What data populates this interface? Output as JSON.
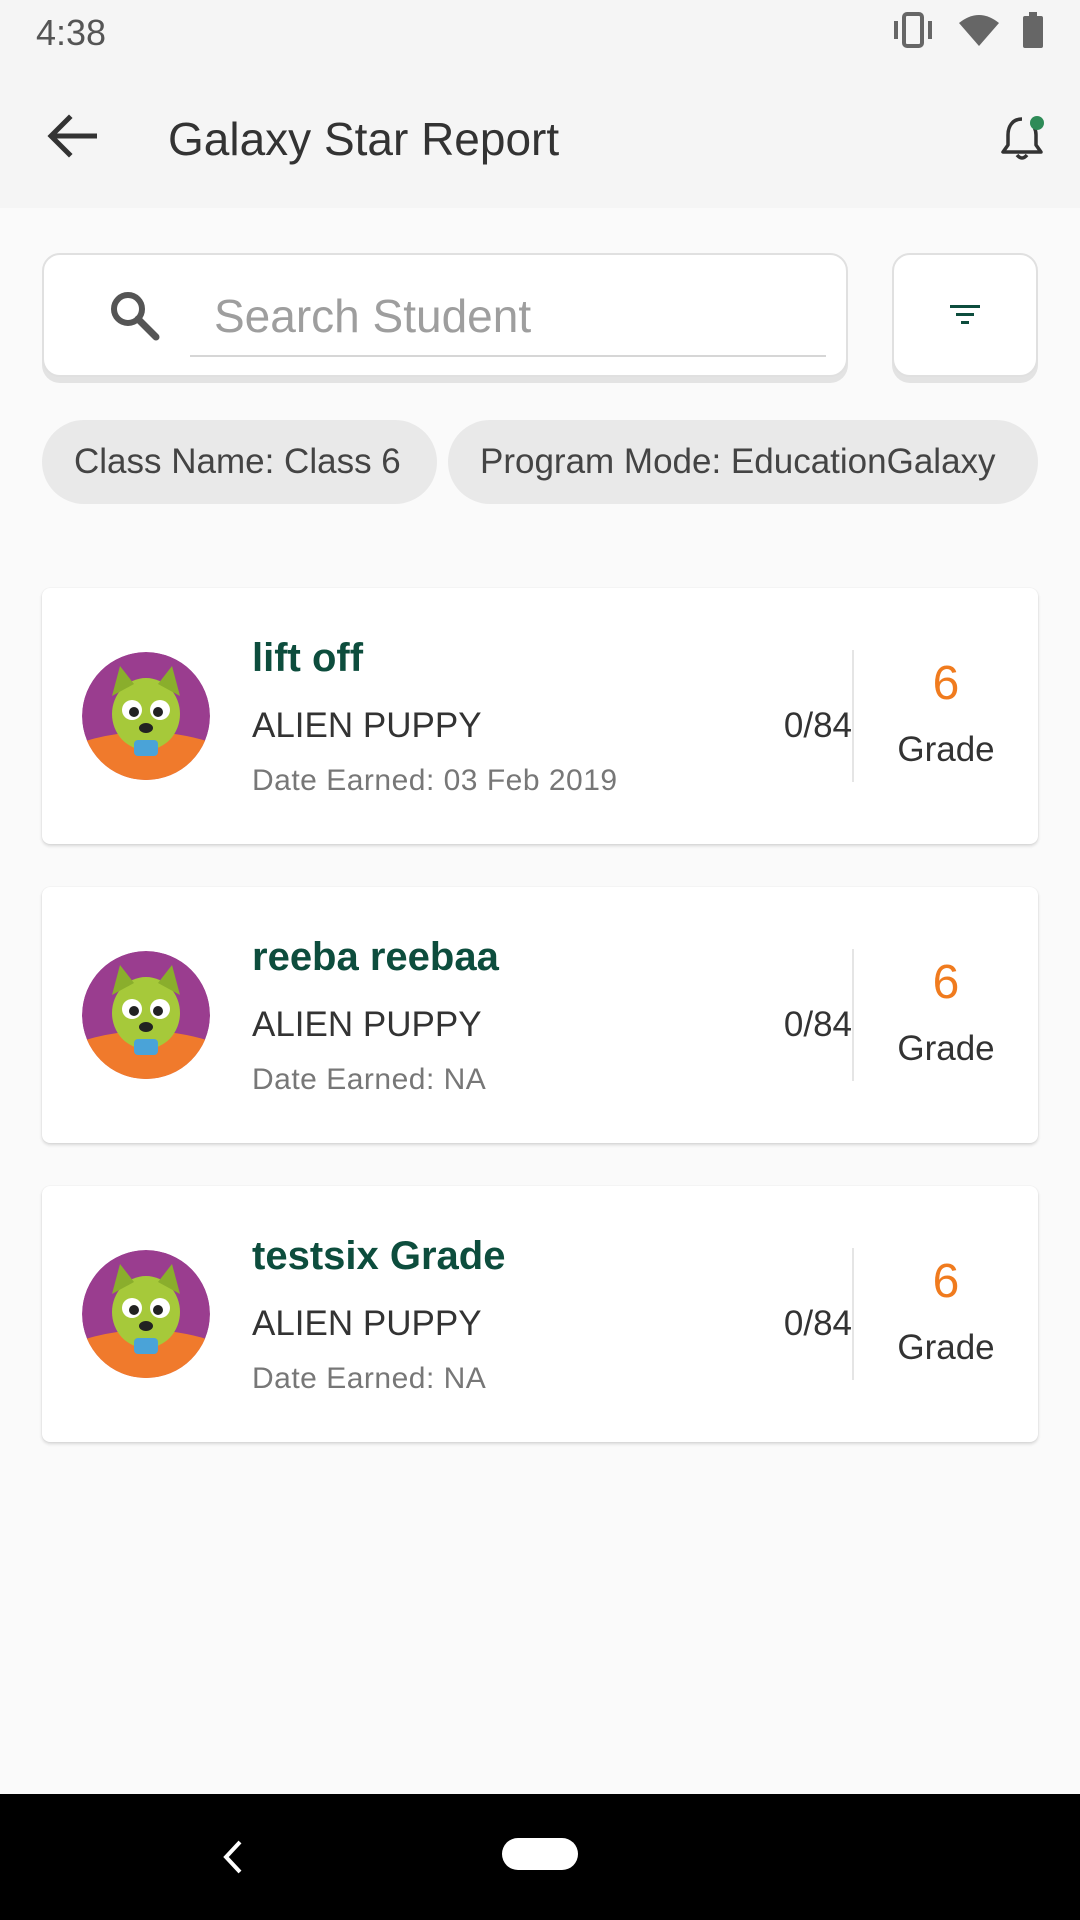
{
  "status_bar": {
    "time": "4:38"
  },
  "app_bar": {
    "title": "Galaxy Star Report"
  },
  "search": {
    "placeholder": "Search Student",
    "value": ""
  },
  "chips": [
    {
      "label": "Class Name: Class 6"
    },
    {
      "label": "Program Mode: EducationGalaxy"
    }
  ],
  "students": [
    {
      "name": "lift off",
      "level": "ALIEN PUPPY",
      "date_earned": "Date Earned: 03 Feb 2019",
      "score": "0/84",
      "grade": "6",
      "grade_label": "Grade"
    },
    {
      "name": "reeba reebaa",
      "level": "ALIEN PUPPY",
      "date_earned": "Date Earned: NA",
      "score": "0/84",
      "grade": "6",
      "grade_label": "Grade"
    },
    {
      "name": "testsix Grade",
      "level": "ALIEN PUPPY",
      "date_earned": "Date Earned: NA",
      "score": "0/84",
      "grade": "6",
      "grade_label": "Grade"
    }
  ],
  "colors": {
    "name_text": "#0d4d3d",
    "grade_accent": "#f07b1e",
    "bell_accent": "#2e8b57"
  }
}
